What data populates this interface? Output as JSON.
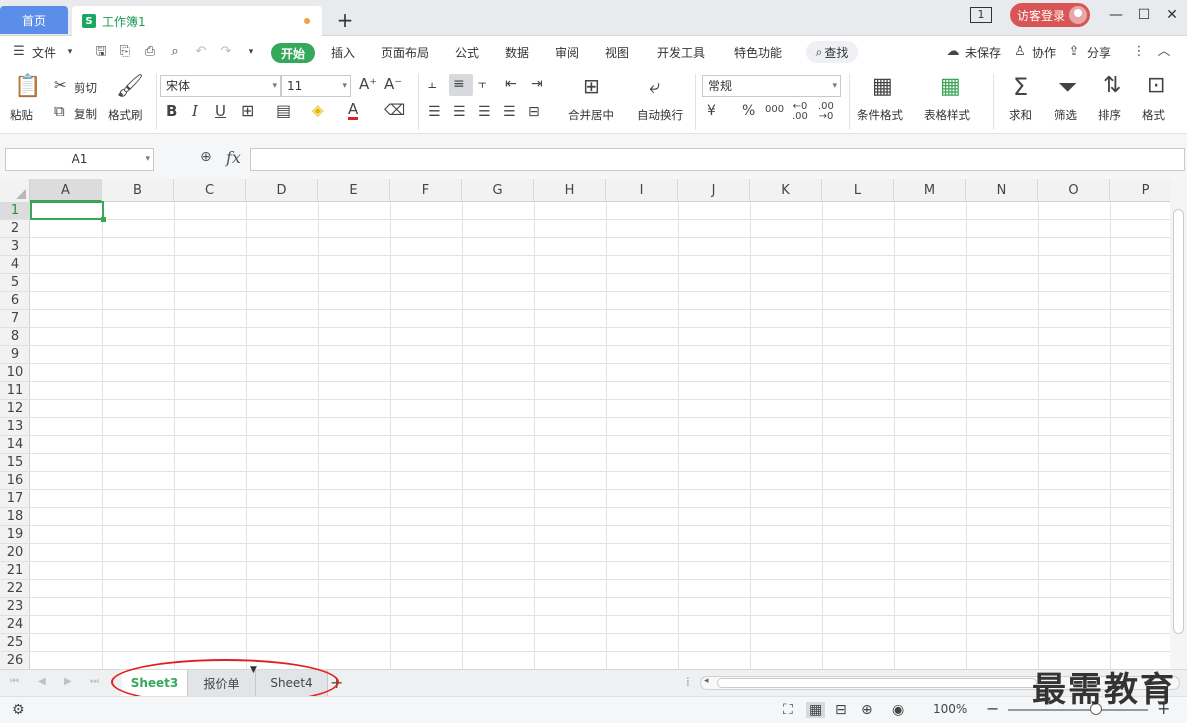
{
  "tabs": {
    "home": "首页",
    "doc_badge": "S",
    "doc_name": "工作簿1",
    "add": "+"
  },
  "window": {
    "box_label": "1",
    "login": "访客登录",
    "minimize": "—",
    "maximize": "☐",
    "close": "✕"
  },
  "menu": {
    "file": "文件",
    "items": [
      "开始",
      "插入",
      "页面布局",
      "公式",
      "数据",
      "审阅",
      "视图",
      "开发工具",
      "特色功能"
    ],
    "search": "查找",
    "unsaved": "未保存",
    "collab": "协作",
    "share": "分享"
  },
  "ribbon": {
    "paste": "粘贴",
    "cut": "剪切",
    "copy": "复制",
    "format_painter": "格式刷",
    "font": "宋体",
    "size": "11",
    "merge_center": "合并居中",
    "wrap": "自动换行",
    "number_format": "常规",
    "cond_format": "条件格式",
    "table_style": "表格样式",
    "sum": "求和",
    "filter": "筛选",
    "sort": "排序",
    "format": "格式",
    "bold": "B",
    "italic": "I",
    "underline": "U",
    "font_color": "A",
    "currency": "¥",
    "percent": "%",
    "thousands": "000"
  },
  "formula": {
    "name_box": "A1",
    "fx": "fx",
    "value": ""
  },
  "grid": {
    "columns": [
      "A",
      "B",
      "C",
      "D",
      "E",
      "F",
      "G",
      "H",
      "I",
      "J",
      "K",
      "L",
      "M",
      "N",
      "O",
      "P"
    ],
    "rows": [
      "1",
      "2",
      "3",
      "4",
      "5",
      "6",
      "7",
      "8",
      "9",
      "10",
      "11",
      "12",
      "13",
      "14",
      "15",
      "16",
      "17",
      "18",
      "19",
      "20",
      "21",
      "22",
      "23",
      "24",
      "25",
      "26"
    ],
    "active_cell": "A1"
  },
  "sheets": [
    {
      "name": "Sheet3",
      "active": true
    },
    {
      "name": "报价单",
      "active": false
    },
    {
      "name": "Sheet4",
      "active": false
    }
  ],
  "status": {
    "zoom": "100%",
    "zoom_out": "−",
    "zoom_in": "+"
  },
  "watermark": "最需教育",
  "colors": {
    "accent": "#35a85b",
    "home_tab": "#5b8ee8",
    "login": "#d95454",
    "annotation": "#e02020"
  }
}
